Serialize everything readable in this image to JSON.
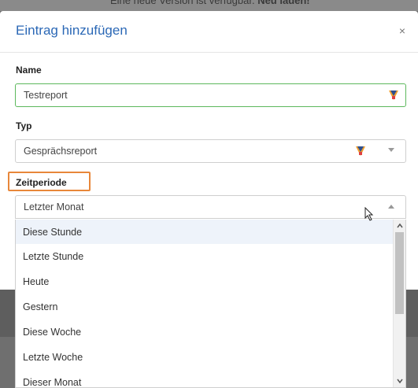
{
  "banner": {
    "text": "Eine neue Version ist verfügbar.",
    "link": "Neu laden!"
  },
  "modal": {
    "title": "Eintrag hinzufügen",
    "close": "×"
  },
  "form": {
    "name": {
      "label": "Name",
      "value": "Testreport"
    },
    "typ": {
      "label": "Typ",
      "value": "Gesprächsreport"
    },
    "zeitperiode": {
      "label": "Zeitperiode",
      "value": "Letzter Monat"
    }
  },
  "dropdown": {
    "options": [
      "Diese Stunde",
      "Letzte Stunde",
      "Heute",
      "Gestern",
      "Diese Woche",
      "Letzte Woche",
      "Dieser Monat"
    ],
    "highlighted_index": 0
  },
  "colors": {
    "title": "#2b68b6",
    "valid_border": "#5cb85c",
    "highlight_box": "#e8873a"
  },
  "icons": {
    "input_extension": "password-manager-icon",
    "close": "close-icon",
    "cursor": "mouse-pointer-icon"
  }
}
